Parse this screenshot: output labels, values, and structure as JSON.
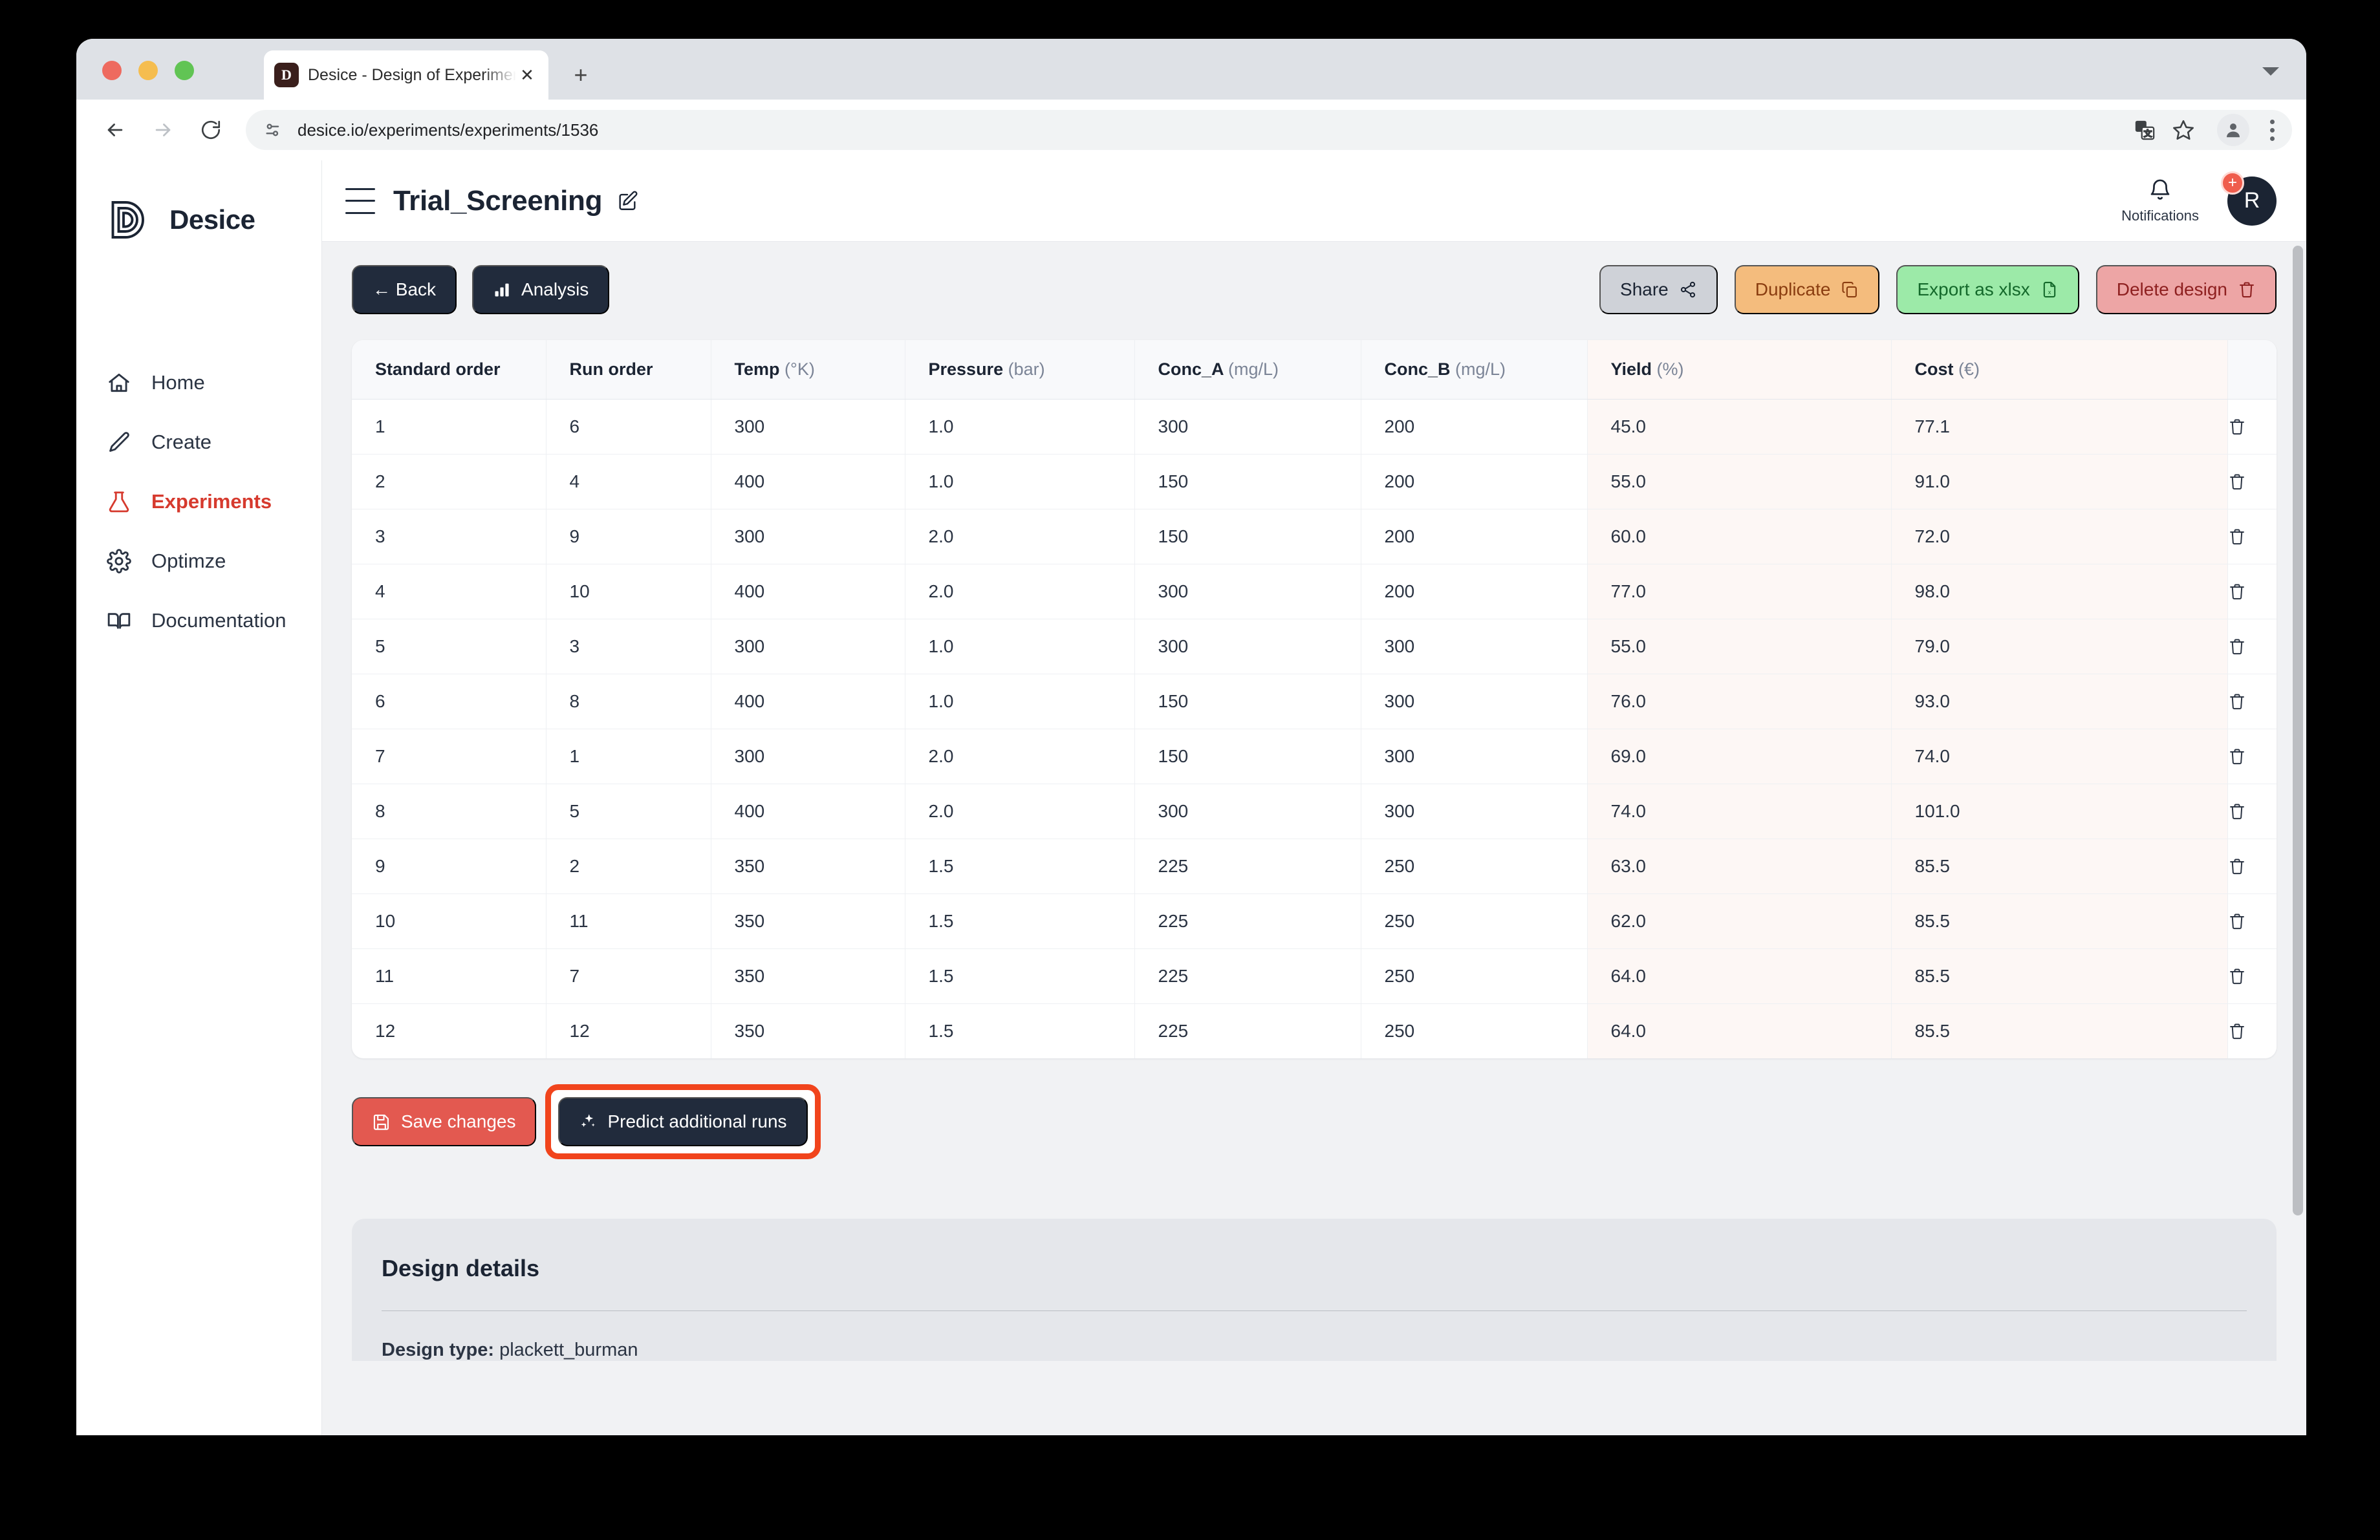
{
  "browser": {
    "tab": {
      "title": "Desice - Design of Experimen",
      "favicon": "D",
      "close_icon": "close-icon",
      "new_tab_icon": "plus-icon"
    },
    "url": "desice.io/experiments/experiments/1536",
    "nav": {
      "back": "back-arrow-icon",
      "forward": "forward-arrow-icon",
      "reload": "reload-icon"
    },
    "toolbar_icons": [
      "translate-icon",
      "bookmark-star-icon",
      "profile-icon",
      "kebab-menu-icon"
    ]
  },
  "sidebar": {
    "brand": "Desice",
    "items": [
      {
        "label": "Home",
        "icon": "home-icon",
        "active": false
      },
      {
        "label": "Create",
        "icon": "pencil-icon",
        "active": false
      },
      {
        "label": "Experiments",
        "icon": "flask-icon",
        "active": true
      },
      {
        "label": "Optimze",
        "icon": "gear-icon",
        "active": false
      },
      {
        "label": "Documentation",
        "icon": "book-icon",
        "active": false
      }
    ],
    "active_color": "#d63a2e"
  },
  "topbar": {
    "menu_icon": "hamburger-icon",
    "title": "Trial_Screening",
    "edit_icon": "pencil-square-icon",
    "notifications_label": "Notifications",
    "notifications_icon": "bell-icon",
    "avatar_initial": "R",
    "avatar_badge": "+"
  },
  "actions": {
    "back": "← Back",
    "analysis": "Analysis",
    "share": "Share",
    "duplicate": "Duplicate",
    "export": "Export as xlsx",
    "delete": "Delete design"
  },
  "table": {
    "columns": [
      {
        "name": "Standard order",
        "unit": ""
      },
      {
        "name": "Run order",
        "unit": ""
      },
      {
        "name": "Temp",
        "unit": "(°K)"
      },
      {
        "name": "Pressure",
        "unit": "(bar)"
      },
      {
        "name": "Conc_A",
        "unit": "(mg/L)"
      },
      {
        "name": "Conc_B",
        "unit": "(mg/L)"
      },
      {
        "name": "Yield",
        "unit": "(%)"
      },
      {
        "name": "Cost",
        "unit": "(€)"
      }
    ],
    "response_columns": [
      "Yield",
      "Cost"
    ],
    "row_delete_icon": "trash-icon",
    "rows": [
      [
        "1",
        "6",
        "300",
        "1.0",
        "300",
        "200",
        "45.0",
        "77.1"
      ],
      [
        "2",
        "4",
        "400",
        "1.0",
        "150",
        "200",
        "55.0",
        "91.0"
      ],
      [
        "3",
        "9",
        "300",
        "2.0",
        "150",
        "200",
        "60.0",
        "72.0"
      ],
      [
        "4",
        "10",
        "400",
        "2.0",
        "300",
        "200",
        "77.0",
        "98.0"
      ],
      [
        "5",
        "3",
        "300",
        "1.0",
        "300",
        "300",
        "55.0",
        "79.0"
      ],
      [
        "6",
        "8",
        "400",
        "1.0",
        "150",
        "300",
        "76.0",
        "93.0"
      ],
      [
        "7",
        "1",
        "300",
        "2.0",
        "150",
        "300",
        "69.0",
        "74.0"
      ],
      [
        "8",
        "5",
        "400",
        "2.0",
        "300",
        "300",
        "74.0",
        "101.0"
      ],
      [
        "9",
        "2",
        "350",
        "1.5",
        "225",
        "250",
        "63.0",
        "85.5"
      ],
      [
        "10",
        "11",
        "350",
        "1.5",
        "225",
        "250",
        "62.0",
        "85.5"
      ],
      [
        "11",
        "7",
        "350",
        "1.5",
        "225",
        "250",
        "64.0",
        "85.5"
      ],
      [
        "12",
        "12",
        "350",
        "1.5",
        "225",
        "250",
        "64.0",
        "85.5"
      ]
    ]
  },
  "bottom": {
    "save": "Save changes",
    "save_icon": "save-disk-icon",
    "predict": "Predict additional runs",
    "predict_icon": "sparkles-icon",
    "highlight_color": "#f1441c"
  },
  "design_details": {
    "title": "Design details",
    "type_label": "Design type:",
    "type_value": "plackett_burman"
  }
}
